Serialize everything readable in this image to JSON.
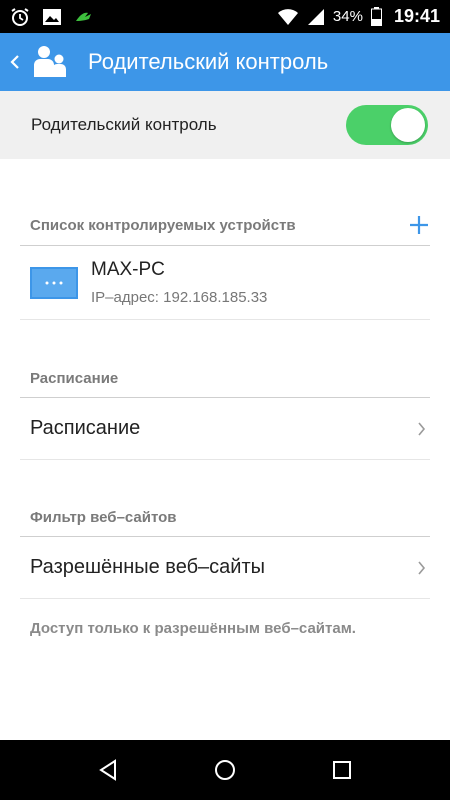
{
  "status_bar": {
    "battery_percent": "34%",
    "time": "19:41",
    "icons": [
      "alarm-icon",
      "image-icon",
      "app-notification-icon",
      "wifi-icon",
      "signal-icon",
      "battery-icon"
    ]
  },
  "app_bar": {
    "title": "Родительский контроль",
    "icons": [
      "back-icon",
      "users-icon"
    ]
  },
  "parental_control": {
    "label": "Родительский контроль",
    "enabled": true
  },
  "devices": {
    "header": "Список контролируемых устройств",
    "items": [
      {
        "name": "MAX-PC",
        "ip": "IP–адрес: 192.168.185.33"
      }
    ]
  },
  "schedule": {
    "header": "Расписание",
    "item_label": "Расписание"
  },
  "web_filter": {
    "header": "Фильтр веб–сайтов",
    "item_label": "Разрешённые веб–сайты",
    "note": "Доступ только к разрешённым веб–сайтам."
  },
  "colors": {
    "accent": "#3d96e8",
    "toggle_on": "#4bd069"
  }
}
